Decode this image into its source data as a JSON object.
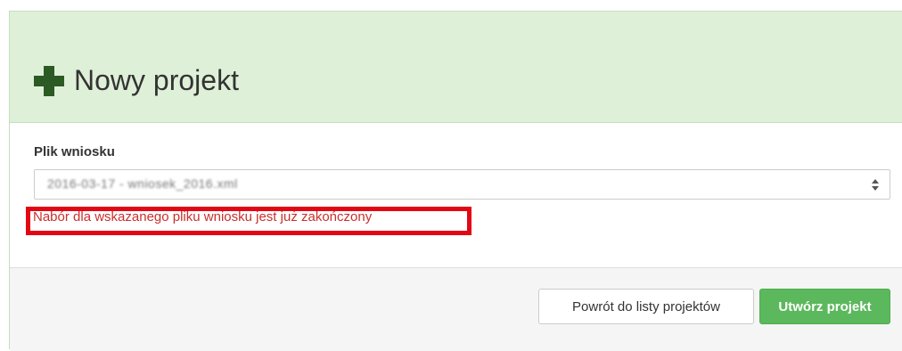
{
  "header": {
    "title": "Nowy projekt",
    "icon": "plus-icon"
  },
  "form": {
    "field_label": "Plik wniosku",
    "select_value": "2016-03-17 - wniosek_2016.xml",
    "error_message": "Nabór dla wskazanego pliku wniosku jest już zakończony"
  },
  "footer": {
    "back_label": "Powrót do listy projektów",
    "create_label": "Utwórz projekt"
  },
  "colors": {
    "heading_bg": "#dff0d8",
    "icon": "#2c5a24",
    "error_text": "#c9302c",
    "error_highlight": "#e30613",
    "primary_button": "#5cb85c"
  }
}
